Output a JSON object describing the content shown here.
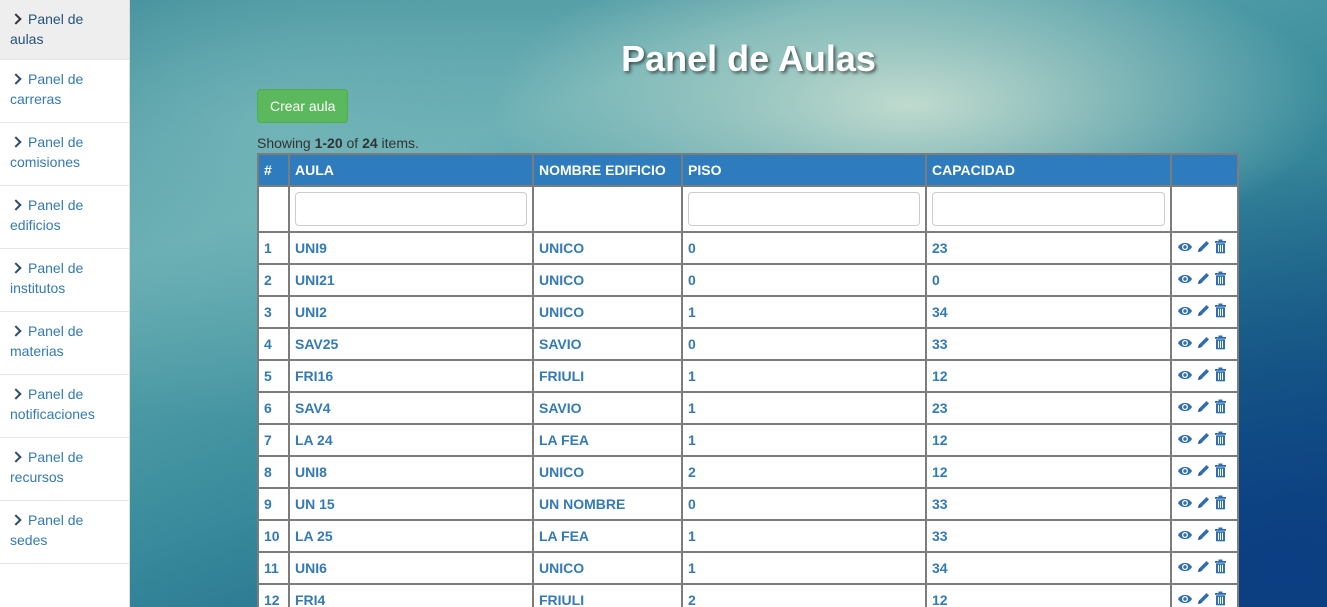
{
  "sidebar": {
    "items": [
      {
        "label": "Panel de aulas"
      },
      {
        "label": "Panel de carreras"
      },
      {
        "label": "Panel de comisiones"
      },
      {
        "label": "Panel de edificios"
      },
      {
        "label": "Panel de institutos"
      },
      {
        "label": "Panel de materias"
      },
      {
        "label": "Panel de notificaciones"
      },
      {
        "label": "Panel de recursos"
      },
      {
        "label": "Panel de sedes"
      }
    ]
  },
  "page": {
    "title": "Panel de Aulas",
    "create_button": "Crear aula",
    "summary": {
      "prefix": "Showing ",
      "range": "1-20",
      "of": " of ",
      "total": "24",
      "suffix": " items."
    }
  },
  "table": {
    "columns": [
      "#",
      "AULA",
      "NOMBRE EDIFICIO",
      "PISO",
      "CAPACIDAD",
      ""
    ],
    "rows": [
      [
        "1",
        "UNI9",
        "UNICO",
        "0",
        "23"
      ],
      [
        "2",
        "UNI21",
        "UNICO",
        "0",
        "0"
      ],
      [
        "3",
        "UNI2",
        "UNICO",
        "1",
        "34"
      ],
      [
        "4",
        "SAV25",
        "SAVIO",
        "0",
        "33"
      ],
      [
        "5",
        "FRI16",
        "FRIULI",
        "1",
        "12"
      ],
      [
        "6",
        "SAV4",
        "SAVIO",
        "1",
        "23"
      ],
      [
        "7",
        "LA 24",
        "LA FEA",
        "1",
        "12"
      ],
      [
        "8",
        "UNI8",
        "UNICO",
        "2",
        "12"
      ],
      [
        "9",
        "UN 15",
        "UN NOMBRE",
        "0",
        "33"
      ],
      [
        "10",
        "LA 25",
        "LA FEA",
        "1",
        "33"
      ],
      [
        "11",
        "UNI6",
        "UNICO",
        "1",
        "34"
      ],
      [
        "12",
        "FRI4",
        "FRIULI",
        "2",
        "12"
      ]
    ],
    "row_actions": [
      "eye-icon",
      "pencil-icon",
      "trash-icon"
    ]
  },
  "colors": {
    "header_bg": "#2e7bbd",
    "link": "#337ab7",
    "create_button": "#5cb85c"
  }
}
